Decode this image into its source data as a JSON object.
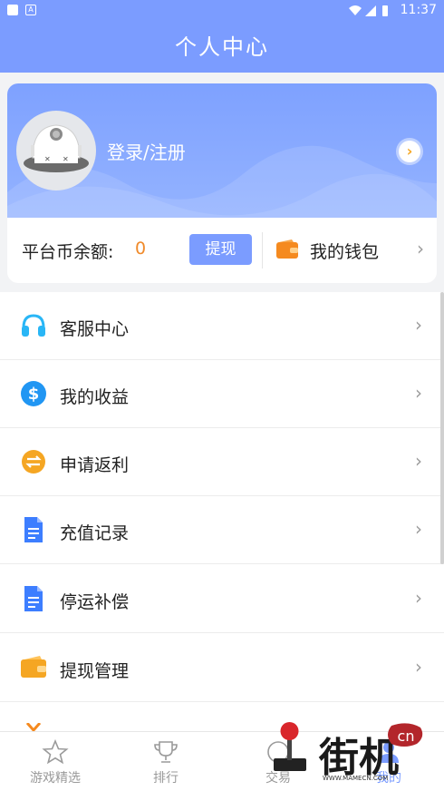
{
  "status_bar": {
    "time": "11:37"
  },
  "header": {
    "title": "个人中心"
  },
  "profile": {
    "login_label": "登录/注册"
  },
  "balance": {
    "label": "平台币余额:",
    "value": "0",
    "withdraw_button": "提现",
    "wallet_label": "我的钱包"
  },
  "menu": {
    "items": [
      {
        "label": "客服中心",
        "icon": "headset-icon"
      },
      {
        "label": "我的收益",
        "icon": "dollar-icon"
      },
      {
        "label": "申请返利",
        "icon": "exchange-icon"
      },
      {
        "label": "充值记录",
        "icon": "document-icon"
      },
      {
        "label": "停运补偿",
        "icon": "document-icon"
      },
      {
        "label": "提现管理",
        "icon": "wallet-icon"
      }
    ]
  },
  "tabs": [
    {
      "label": "游戏精选",
      "icon": "star-icon"
    },
    {
      "label": "排行",
      "icon": "trophy-icon"
    },
    {
      "label": "交易",
      "icon": "trade-icon"
    },
    {
      "label": "我的",
      "icon": "user-icon"
    }
  ],
  "watermark": {
    "main": "街机",
    "badge": "cn",
    "url": "WWW.MAMECN.COM"
  },
  "colors": {
    "primary": "#7b9cff",
    "accent_orange": "#f08a2a"
  }
}
